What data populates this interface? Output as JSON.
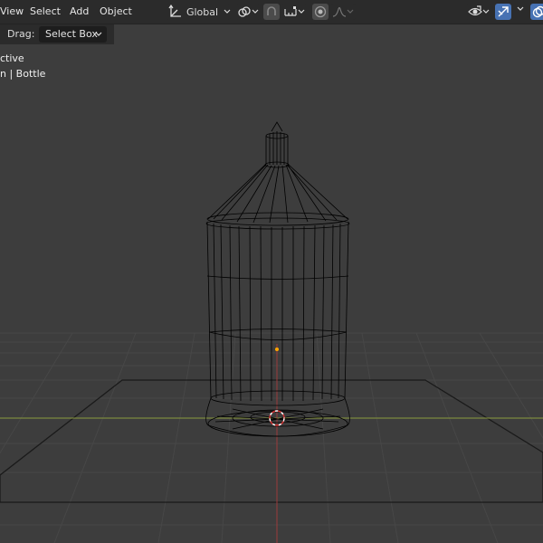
{
  "header": {
    "menu": [
      {
        "label": "View"
      },
      {
        "label": "Select"
      },
      {
        "label": "Add"
      },
      {
        "label": "Object"
      }
    ],
    "transform_orientation": "Global",
    "icons": [
      "transform-orientation-icon",
      "link-icon",
      "snap-icon",
      "snap-increment-icon",
      "proportional-edit-icon",
      "falloff-icon",
      "visibility-icon",
      "gizmo-icon",
      "overlay-icon"
    ]
  },
  "tool_settings": {
    "drag_label": "Drag:",
    "drag_value": "Select Box"
  },
  "viewport_overlay": {
    "line1": "ctive",
    "line2": "n | Bottle"
  },
  "colors": {
    "background": "#3d3d3d",
    "header": "#2b2b2b",
    "active_blue": "#4772b3",
    "x_axis": "#9c3a3a",
    "y_axis": "#8a9a3e",
    "wire": "#000000",
    "origin": "#ffa500"
  }
}
